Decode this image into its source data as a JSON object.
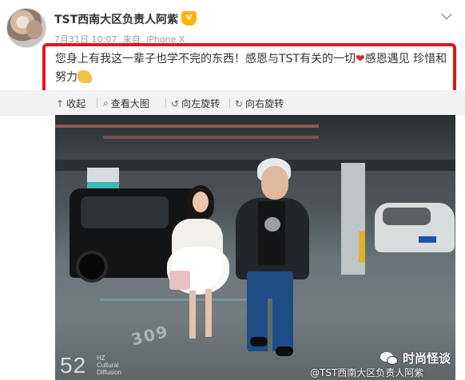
{
  "post": {
    "username": "TST西南大区负责人阿紫",
    "vip_badge": "V",
    "date": "7月31日 10:07",
    "source_prefix": "来自",
    "source": "iPhone X",
    "text_part1": "您身上有我这一辈子也学不完的东西！感恩与TST有关的一切",
    "heart": "❤",
    "text_part2": "感恩遇见 珍惜和努力"
  },
  "toolbar": {
    "collapse_label": "收起",
    "view_large_label": "查看大图",
    "rotate_left_label": "向左旋转",
    "rotate_right_label": "向右旋转"
  },
  "photo": {
    "floor_number": "309",
    "logo_number": "52",
    "logo_hz": "HZ",
    "logo_sub1": "Cultural",
    "logo_sub2": "Diffusion"
  },
  "watermarks": {
    "wechat_account": "时尚怪谈",
    "weibo_handle": "@TST西南大区负责人阿紫"
  },
  "colors": {
    "highlight_border": "#e4161a",
    "toolbar_bg": "#f2f2f5",
    "vip_badge": "#f7b500"
  }
}
